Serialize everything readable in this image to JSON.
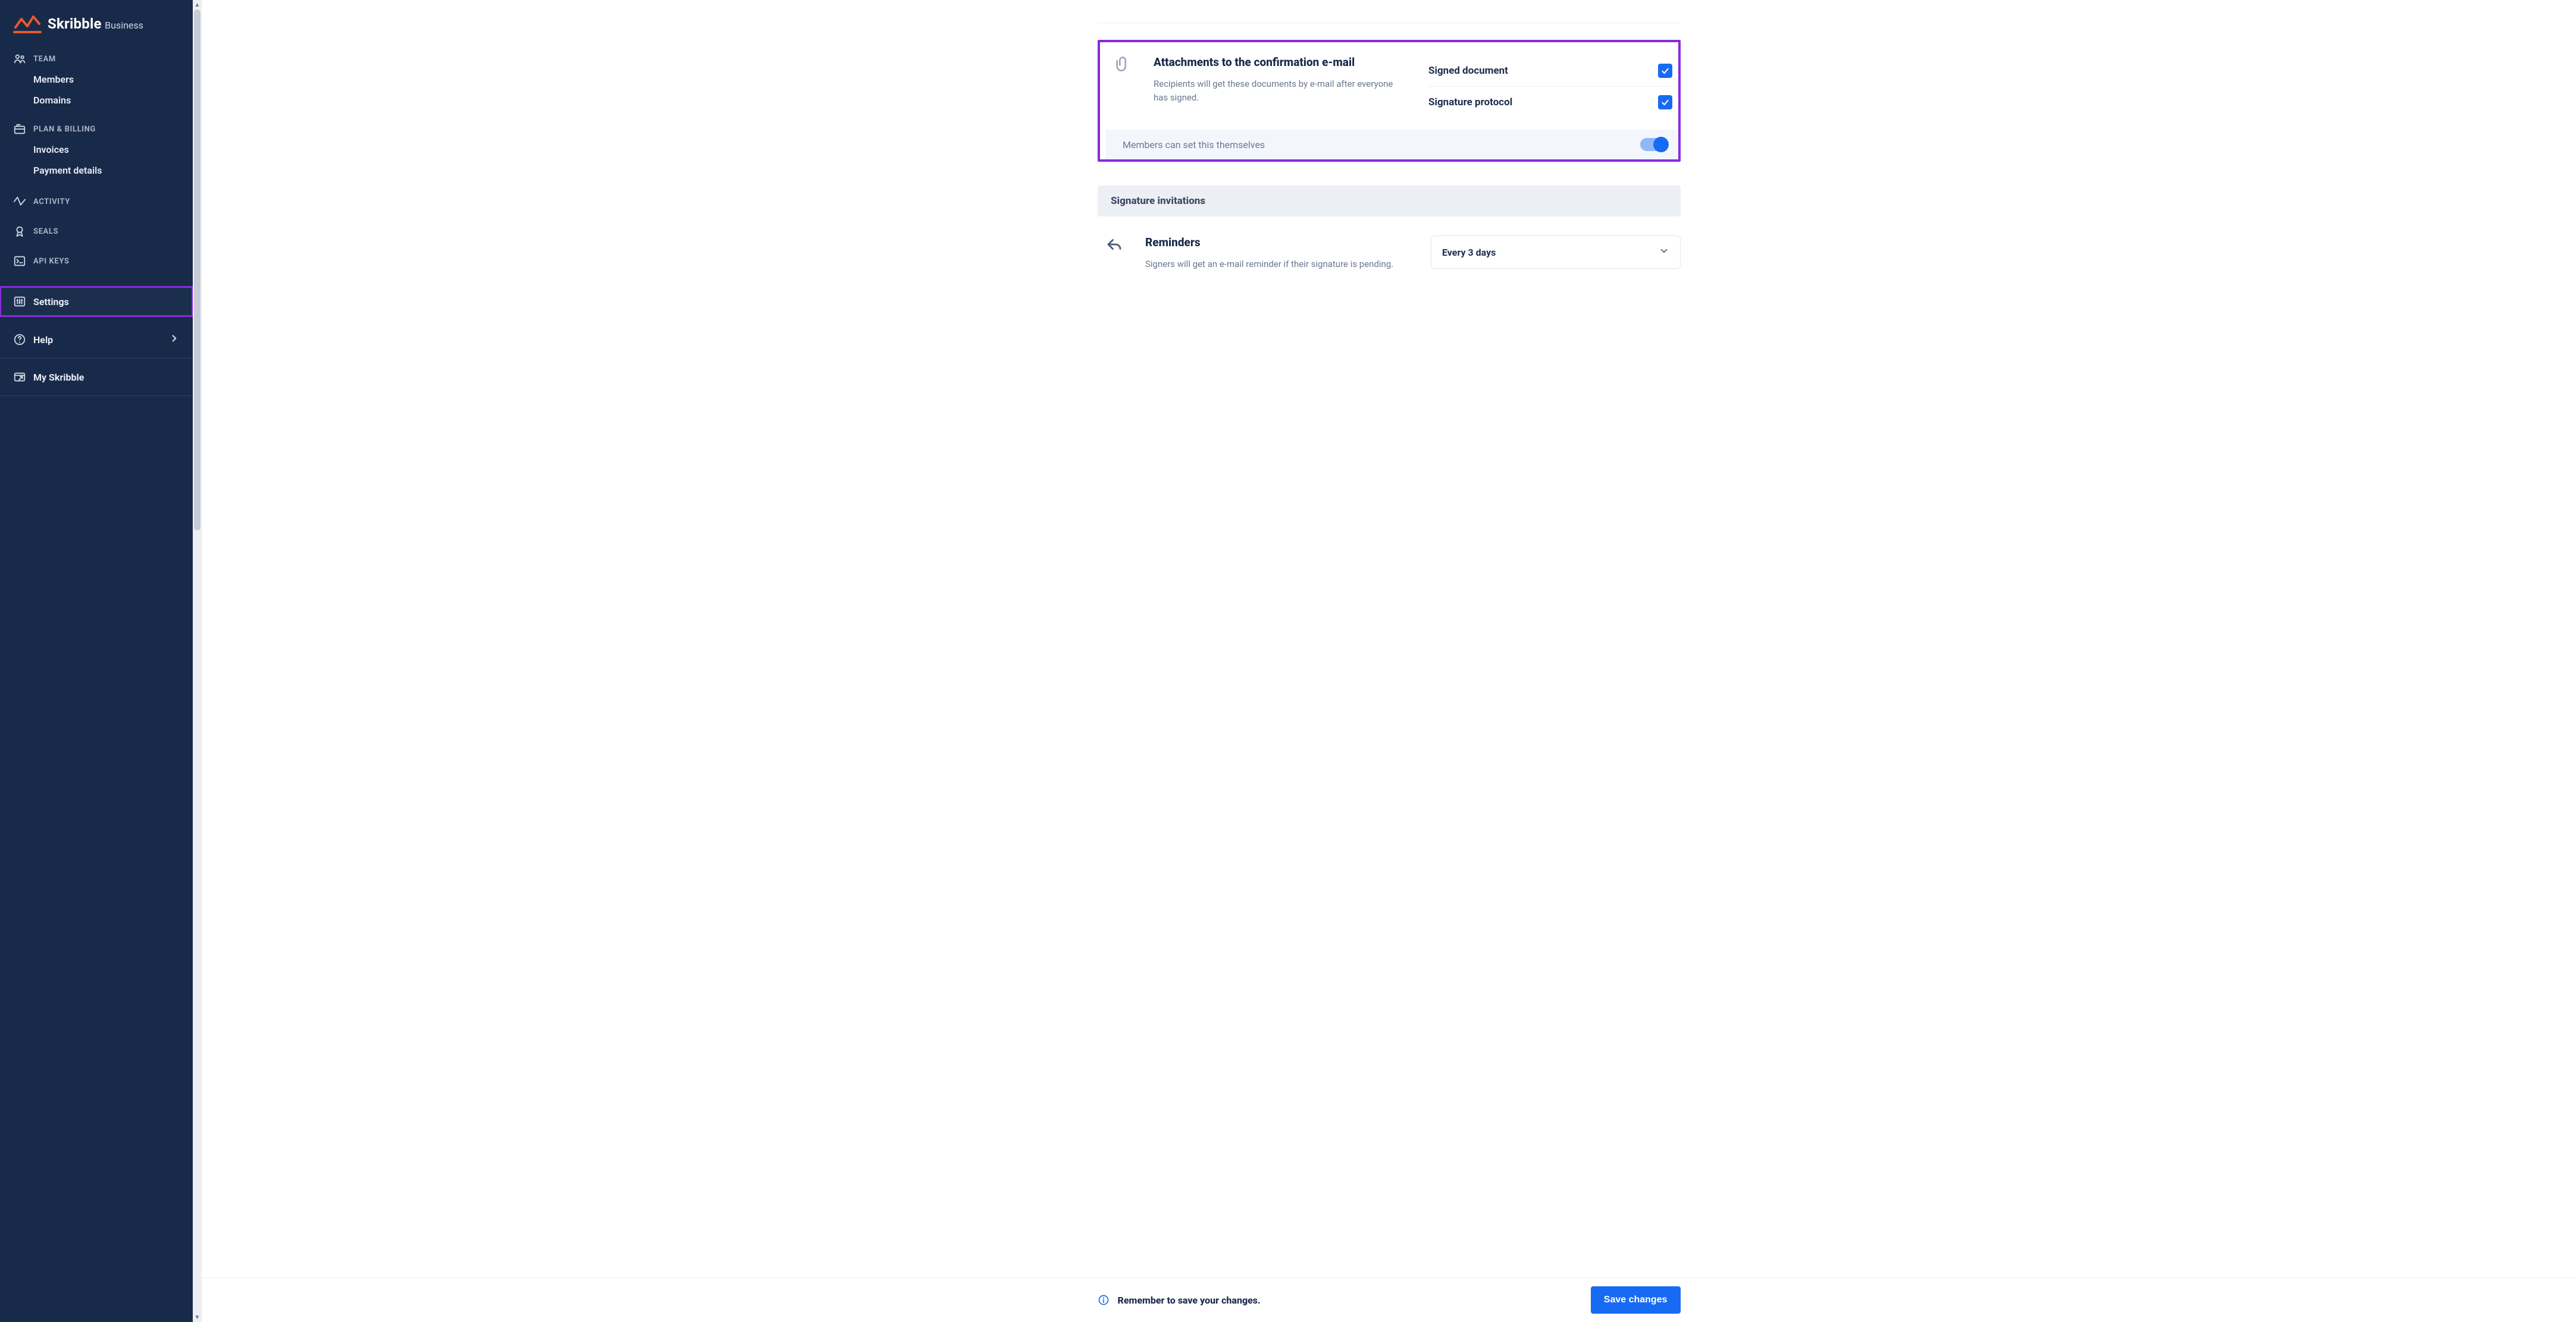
{
  "brand": {
    "name": "Skribble",
    "suffix": "Business"
  },
  "sidebar": {
    "team": {
      "heading": "TEAM",
      "members": "Members",
      "domains": "Domains"
    },
    "billing": {
      "heading": "PLAN & BILLING",
      "invoices": "Invoices",
      "payment_details": "Payment details"
    },
    "activity": "ACTIVITY",
    "seals": "SEALS",
    "apikeys": "API KEYS",
    "settings": "Settings",
    "help": "Help",
    "my_skribble": "My Skribble"
  },
  "attachments": {
    "title": "Attachments to the confirmation e-mail",
    "description": "Recipients will get these documents by e-mail after everyone has signed.",
    "options": {
      "signed_document": {
        "label": "Signed document",
        "checked": true
      },
      "signature_protocol": {
        "label": "Signature protocol",
        "checked": true
      }
    },
    "members_row": "Members can set this themselves",
    "members_toggle": true
  },
  "invitations": {
    "heading": "Signature invitations",
    "reminders": {
      "title": "Reminders",
      "description": "Signers will get an e-mail reminder if their signature is pending.",
      "selected": "Every 3 days"
    }
  },
  "savebar": {
    "note": "Remember to save your changes.",
    "button": "Save changes"
  }
}
